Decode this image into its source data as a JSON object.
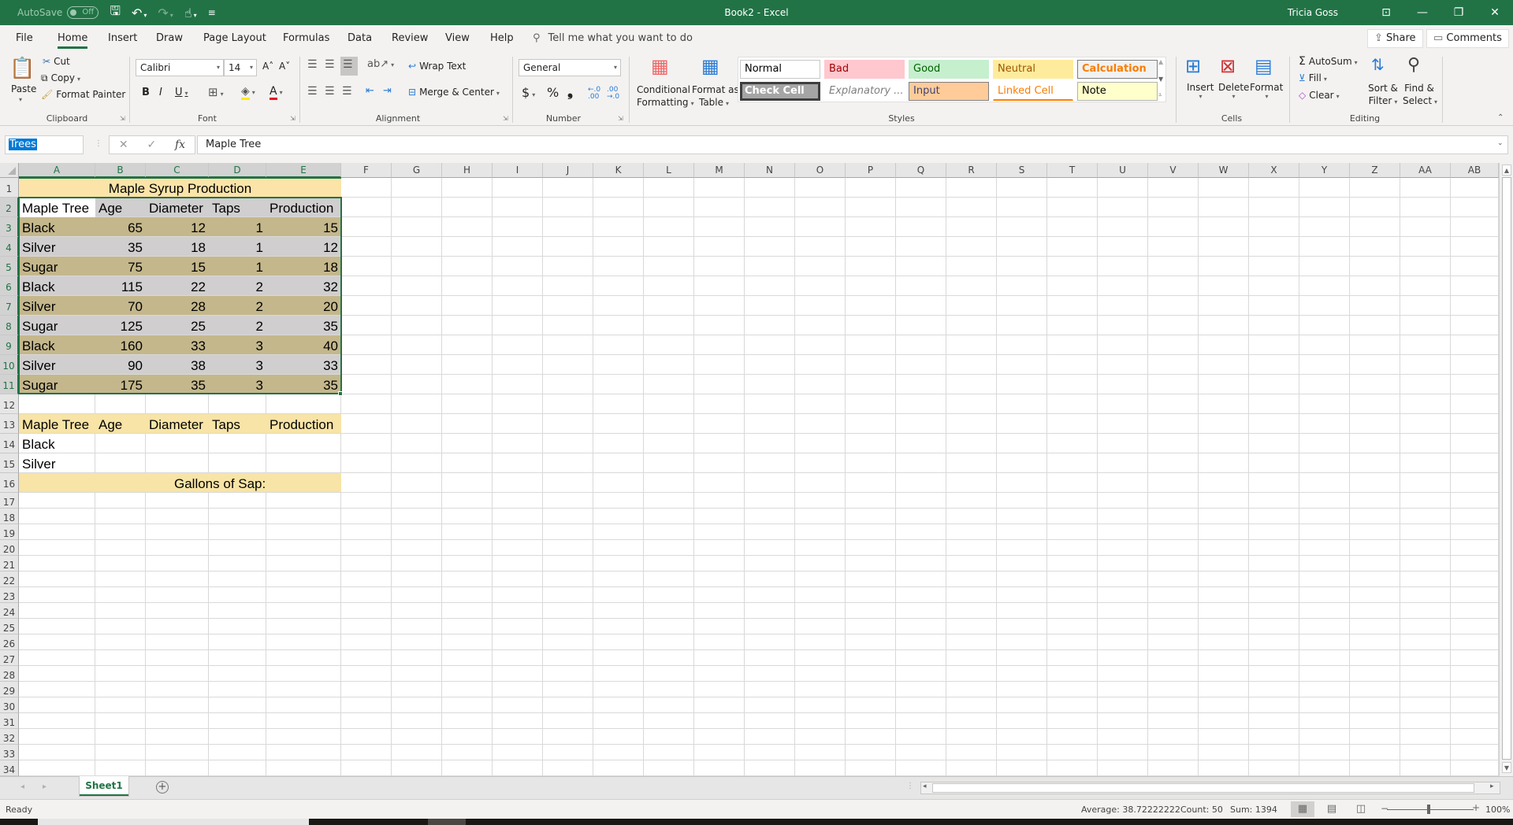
{
  "window": {
    "document_title": "Book2  -  Excel",
    "user": "Tricia Goss",
    "autosave_label": "AutoSave",
    "autosave_state": "Off"
  },
  "qat": [
    {
      "icon": "save-icon",
      "glyph": "🖫"
    },
    {
      "icon": "undo-icon",
      "glyph": "↶"
    },
    {
      "icon": "redo-icon",
      "glyph": "↷"
    },
    {
      "icon": "touch-mode-icon",
      "glyph": "☝"
    },
    {
      "icon": "customize-qat-icon",
      "glyph": "≡"
    }
  ],
  "window_controls": {
    "ribbon_display_glyph": "⊡",
    "minimize_glyph": "—",
    "restore_glyph": "❐",
    "close_glyph": "✕"
  },
  "ribbon_tabs": [
    "File",
    "Home",
    "Insert",
    "Draw",
    "Page Layout",
    "Formulas",
    "Data",
    "Review",
    "View",
    "Help"
  ],
  "active_tab": "Home",
  "tell_me": "Tell me what you want to do",
  "share_label": "Share",
  "comments_label": "Comments",
  "clipboard": {
    "label": "Clipboard",
    "paste": "Paste",
    "cut": "Cut",
    "copy": "Copy",
    "format_painter": "Format Painter"
  },
  "font": {
    "label": "Font",
    "name": "Calibri",
    "size": "14",
    "bold": "B",
    "italic": "I",
    "underline": "U",
    "grow": "A˄",
    "shrink": "A˅",
    "font_color_hex": "#e81123"
  },
  "alignment": {
    "label": "Alignment",
    "wrap_text": "Wrap Text",
    "merge_center": "Merge & Center"
  },
  "number": {
    "label": "Number",
    "format": "General",
    "currency": "$",
    "percent": "%",
    "comma": "❟",
    "inc_decimal": "←.0 .00",
    "dec_decimal": ".00 →.0"
  },
  "styles": {
    "label": "Styles",
    "conditional_formatting": "Conditional",
    "conditional_formatting_2": "Formatting",
    "format_as_table": "Format as",
    "format_as_table_2": "Table",
    "gallery": [
      {
        "name": "Normal",
        "bg": "#ffffff",
        "fg": "#000000",
        "border": "#c8c8c8"
      },
      {
        "name": "Bad",
        "bg": "#ffc7ce",
        "fg": "#9c0006",
        "border": "#ffc7ce"
      },
      {
        "name": "Good",
        "bg": "#c6efce",
        "fg": "#006100",
        "border": "#c6efce"
      },
      {
        "name": "Neutral",
        "bg": "#ffeb9c",
        "fg": "#9c5700",
        "border": "#ffeb9c"
      },
      {
        "name": "Calculation",
        "bg": "#f2f2f2",
        "fg": "#fa7d00",
        "border": "#7f7f7f"
      },
      {
        "name": "Check Cell",
        "bg": "#a5a5a5",
        "fg": "#ffffff",
        "border": "#3f3f3f"
      },
      {
        "name": "Explanatory ...",
        "bg": "#ffffff",
        "fg": "#7f7f7f",
        "border": "#ffffff"
      },
      {
        "name": "Input",
        "bg": "#ffcc99",
        "fg": "#3f3f76",
        "border": "#7f7f7f"
      },
      {
        "name": "Linked Cell",
        "bg": "#ffffff",
        "fg": "#fa7d00",
        "border": "#ffffff"
      },
      {
        "name": "Note",
        "bg": "#ffffcc",
        "fg": "#000000",
        "border": "#b2b2b2"
      }
    ]
  },
  "cells_group": {
    "label": "Cells",
    "insert": "Insert",
    "delete": "Delete",
    "format": "Format"
  },
  "editing": {
    "label": "Editing",
    "autosum": "AutoSum",
    "fill": "Fill",
    "clear": "Clear",
    "sort_filter": "Sort &",
    "sort_filter_2": "Filter",
    "find_select": "Find &",
    "find_select_2": "Select"
  },
  "formula_bar": {
    "name_box": "Trees",
    "cancel": "✕",
    "enter": "✓",
    "fx": "fx",
    "value": "Maple Tree"
  },
  "sheet": {
    "columns": [
      "A",
      "B",
      "C",
      "D",
      "E",
      "F",
      "G",
      "H",
      "I",
      "J",
      "K",
      "L",
      "M",
      "N",
      "O",
      "P",
      "Q",
      "R",
      "S",
      "T",
      "U",
      "V",
      "W",
      "X",
      "Y",
      "Z",
      "AA",
      "AB"
    ],
    "selected_columns": [
      "A",
      "B",
      "C",
      "D",
      "E"
    ],
    "rows": [
      1,
      2,
      3,
      4,
      5,
      6,
      7,
      8,
      9,
      10,
      11,
      12,
      13,
      14,
      15,
      16,
      17,
      18,
      19,
      20,
      21,
      22,
      23,
      24,
      25,
      26,
      27,
      28,
      29,
      30,
      31,
      32,
      33,
      34
    ],
    "selected_rows": [
      2,
      3,
      4,
      5,
      6,
      7,
      8,
      9,
      10,
      11
    ],
    "title": "Maple Syrup Production",
    "headers": [
      "Maple Tree",
      "Age",
      "Diameter",
      "Taps",
      "Production"
    ],
    "data": [
      [
        "Black",
        65,
        12,
        1,
        15
      ],
      [
        "Silver",
        35,
        18,
        1,
        12
      ],
      [
        "Sugar",
        75,
        15,
        1,
        18
      ],
      [
        "Black",
        115,
        22,
        2,
        32
      ],
      [
        "Silver",
        70,
        28,
        2,
        20
      ],
      [
        "Sugar",
        125,
        25,
        2,
        35
      ],
      [
        "Black",
        160,
        33,
        3,
        40
      ],
      [
        "Silver",
        90,
        38,
        3,
        33
      ],
      [
        "Sugar",
        175,
        35,
        3,
        35
      ]
    ],
    "criteria_headers": [
      "Maple Tree",
      "Age",
      "Diameter",
      "Taps",
      "Production"
    ],
    "criteria_rows": [
      "Black",
      "Silver"
    ],
    "gallons_label": "Gallons of Sap:",
    "colors": {
      "title_fill": "#fce4a8",
      "band_dark": "#c4b78b",
      "band_light": "#d0cece",
      "header_fill": "#d0cece",
      "criteria_fill": "#f7e4a6",
      "selection": "#217346"
    }
  },
  "sheet_tabs": [
    "Sheet1"
  ],
  "status": {
    "mode": "Ready",
    "average": "Average: 38.72222222",
    "count": "Count: 50",
    "sum": "Sum: 1394",
    "zoom": "100%"
  }
}
